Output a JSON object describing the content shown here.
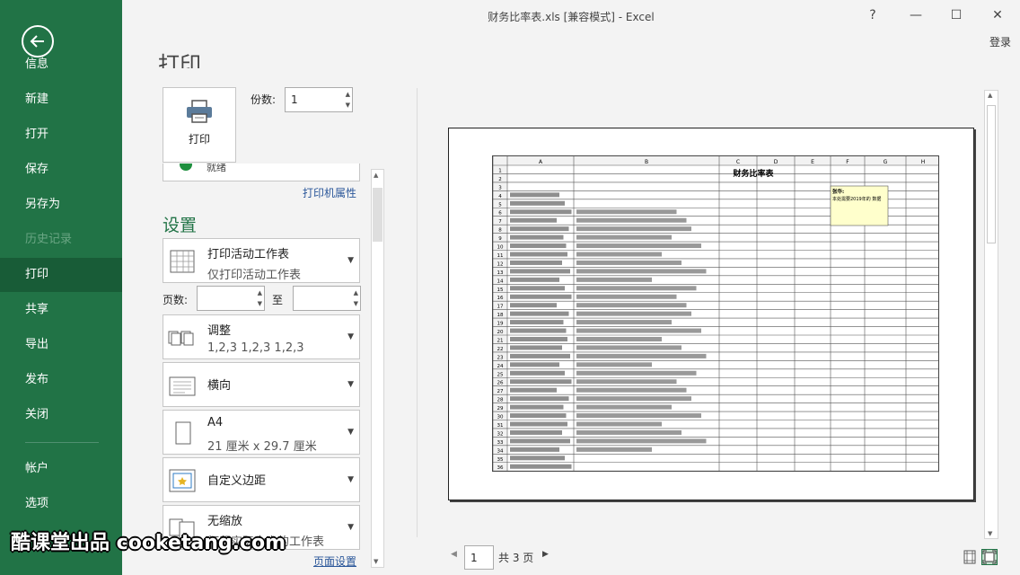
{
  "window": {
    "title": "财务比率表.xls  [兼容模式] - Excel",
    "help": "?",
    "minimize": "—",
    "maximize": "☐",
    "close": "✕",
    "login": "登录"
  },
  "nav": {
    "back_label": "信息",
    "items": [
      {
        "label": "新建",
        "state": "normal"
      },
      {
        "label": "打开",
        "state": "normal"
      },
      {
        "label": "保存",
        "state": "normal"
      },
      {
        "label": "另存为",
        "state": "normal"
      },
      {
        "label": "历史记录",
        "state": "disabled"
      },
      {
        "label": "打印",
        "state": "active"
      },
      {
        "label": "共享",
        "state": "normal"
      },
      {
        "label": "导出",
        "state": "normal"
      },
      {
        "label": "发布",
        "state": "normal"
      },
      {
        "label": "关闭",
        "state": "normal"
      }
    ],
    "bottom_items": [
      {
        "label": "帐户"
      },
      {
        "label": "选项"
      }
    ]
  },
  "print": {
    "heading": "打印",
    "print_button": "打印",
    "copies_label": "份数:",
    "copies_value": "1",
    "printer_status": "就绪",
    "printer_properties": "打印机属性",
    "settings_heading": "设置",
    "settings": [
      {
        "main": "打印活动工作表",
        "sub": "仅打印活动工作表",
        "icon": "sheet-grid-icon"
      },
      {
        "main": "调整",
        "sub": "1,2,3    1,2,3    1,2,3",
        "icon": "collate-icon"
      },
      {
        "main": "横向",
        "sub": "",
        "icon": "landscape-icon"
      },
      {
        "main": "A4",
        "sub": "21 厘米 x 29.7 厘米",
        "icon": "paper-size-icon"
      },
      {
        "main": "自定义边距",
        "sub": "",
        "icon": "margins-icon"
      },
      {
        "main": "无缩放",
        "sub": "打印实际大小的工作表",
        "icon": "no-scaling-icon"
      }
    ],
    "pages_label": "页数:",
    "pages_to": "至",
    "page_setup": "页面设置"
  },
  "preview": {
    "sheet_title": "财务比率表",
    "columns": [
      "A",
      "B",
      "C",
      "D",
      "E",
      "F",
      "G",
      "H"
    ],
    "comment_title": "张华:",
    "comment_text": "本处需要2019年的 数据",
    "current_page": "1",
    "total_pages": "共 3 页"
  },
  "watermark": "酷课堂出品 cooketang.com",
  "colors": {
    "brand_green": "#217346",
    "active_green": "#185c37",
    "link_blue": "#2b579a"
  }
}
